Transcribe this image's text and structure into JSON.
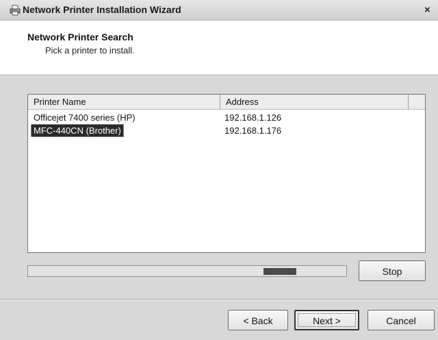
{
  "window": {
    "title": "Network Printer Installation Wizard",
    "icon": "printer-icon",
    "close_glyph": "×"
  },
  "header": {
    "title": "Network Printer Search",
    "subtitle": "Pick a printer to install."
  },
  "printer_list": {
    "columns": [
      "Printer Name",
      "Address",
      ""
    ],
    "rows": [
      {
        "name": "Officejet 7400 series (HP)",
        "address": "192.168.1.126",
        "selected": false
      },
      {
        "name": "MFC-440CN (Brother)",
        "address": "192.168.1.176",
        "selected": true
      }
    ]
  },
  "search": {
    "progress": "indeterminate",
    "stop_label": "Stop"
  },
  "footer": {
    "back_label": "< Back",
    "next_label": "Next >",
    "cancel_label": "Cancel"
  },
  "colors": {
    "selection_bg": "#2b2b2b",
    "progress_fill": "#4a4a4a"
  }
}
